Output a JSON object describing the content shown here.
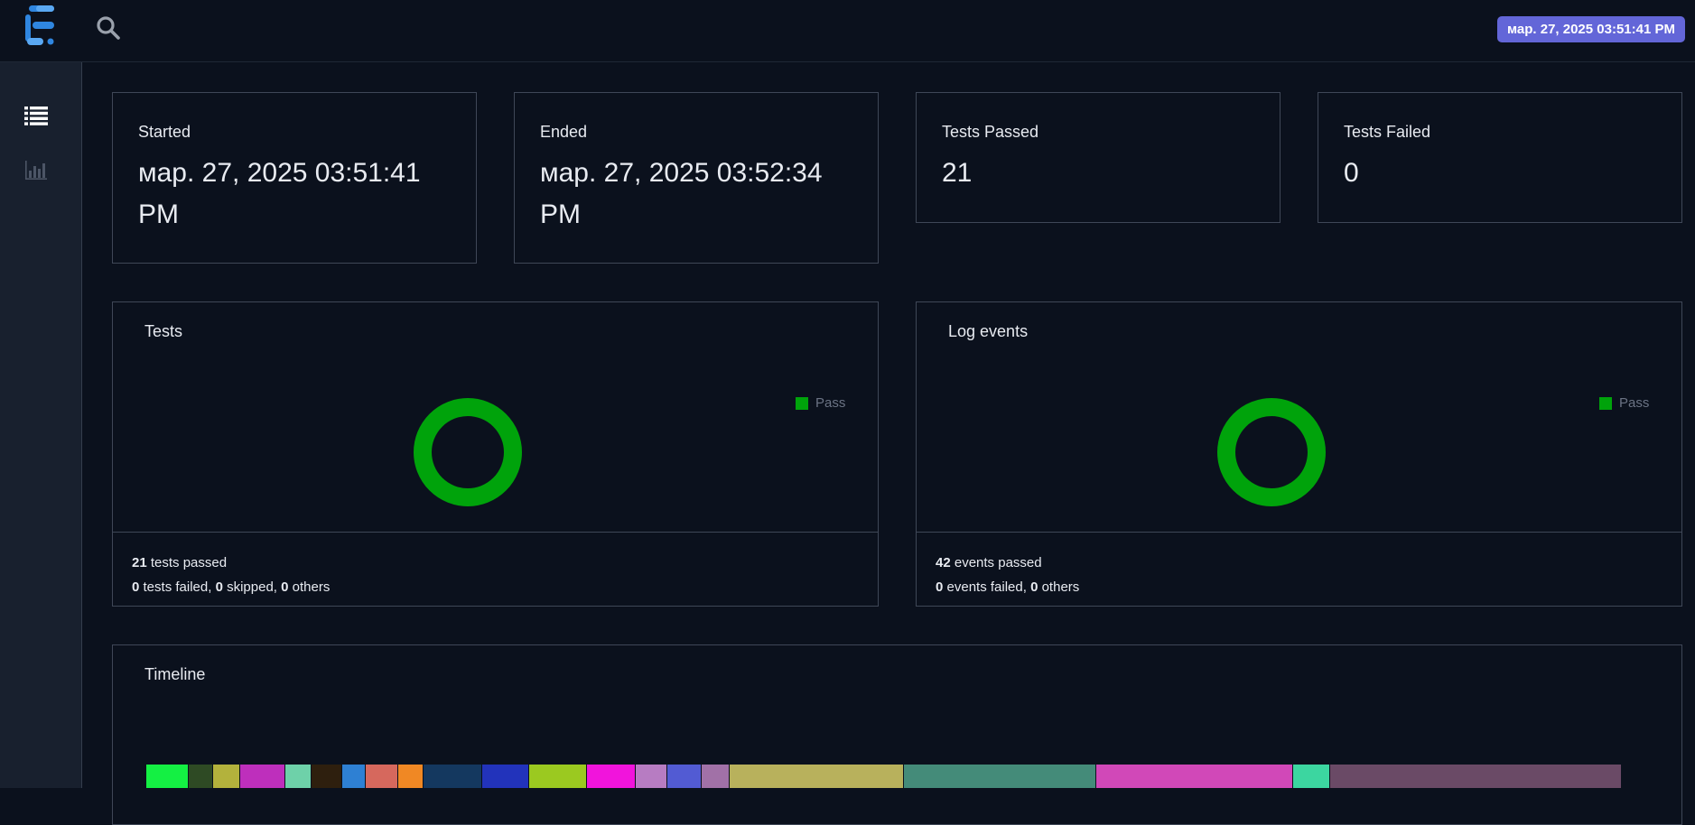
{
  "header": {
    "logo_name": "extent-logo",
    "search_icon": "search-icon",
    "date_badge": "мар. 27, 2025 03:51:41 PM"
  },
  "sidebar": {
    "items": [
      {
        "icon": "list-icon",
        "active": true
      },
      {
        "icon": "bar-chart-icon",
        "active": false
      }
    ]
  },
  "stats": [
    {
      "label": "Started",
      "value": "мар. 27, 2025 03:51:41 PM"
    },
    {
      "label": "Ended",
      "value": "мар. 27, 2025 03:52:34 PM"
    },
    {
      "label": "Tests Passed",
      "value": "21"
    },
    {
      "label": "Tests Failed",
      "value": "0"
    }
  ],
  "tests_chart": {
    "title": "Tests",
    "legend": "Pass",
    "passed_count": "21",
    "passed_text": "tests passed",
    "failed_count": "0",
    "failed_text": "tests failed,",
    "skipped_count": "0",
    "skipped_text": "skipped,",
    "others_count": "0",
    "others_text": "others"
  },
  "events_chart": {
    "title": "Log events",
    "legend": "Pass",
    "passed_count": "42",
    "passed_text": "events passed",
    "failed_count": "0",
    "failed_text": "events failed,",
    "others_count": "0",
    "others_text": "others"
  },
  "timeline": {
    "title": "Timeline"
  },
  "chart_data": [
    {
      "type": "pie",
      "title": "Tests",
      "categories": [
        "Pass"
      ],
      "values": [
        21
      ],
      "colors": [
        "#00a30b"
      ],
      "legend": "top-right"
    },
    {
      "type": "pie",
      "title": "Log events",
      "categories": [
        "Pass"
      ],
      "values": [
        42
      ],
      "colors": [
        "#00a30b"
      ],
      "legend": "top-right"
    },
    {
      "type": "bar",
      "title": "Timeline",
      "orientation": "horizontal-stacked",
      "values": [
        4.7,
        2.7,
        3.0,
        5.0,
        2.9,
        3.4,
        2.6,
        3.6,
        2.8,
        6.5,
        5.2,
        6.4,
        5.4,
        3.5,
        3.8,
        3.1,
        19.3,
        21.3,
        21.8,
        4.1,
        32.3
      ],
      "colors": [
        "#14f043",
        "#2e4a24",
        "#b3b23c",
        "#be2fbc",
        "#6ed1a9",
        "#2e1f0e",
        "#2e80d3",
        "#d6685d",
        "#f08824",
        "#14385f",
        "#2233bb",
        "#9bc920",
        "#f114dc",
        "#b77cc2",
        "#525bd3",
        "#a171a7",
        "#b8b15c",
        "#448b79",
        "#d148b8",
        "#3cd6a0",
        "#6a4a66"
      ]
    }
  ]
}
